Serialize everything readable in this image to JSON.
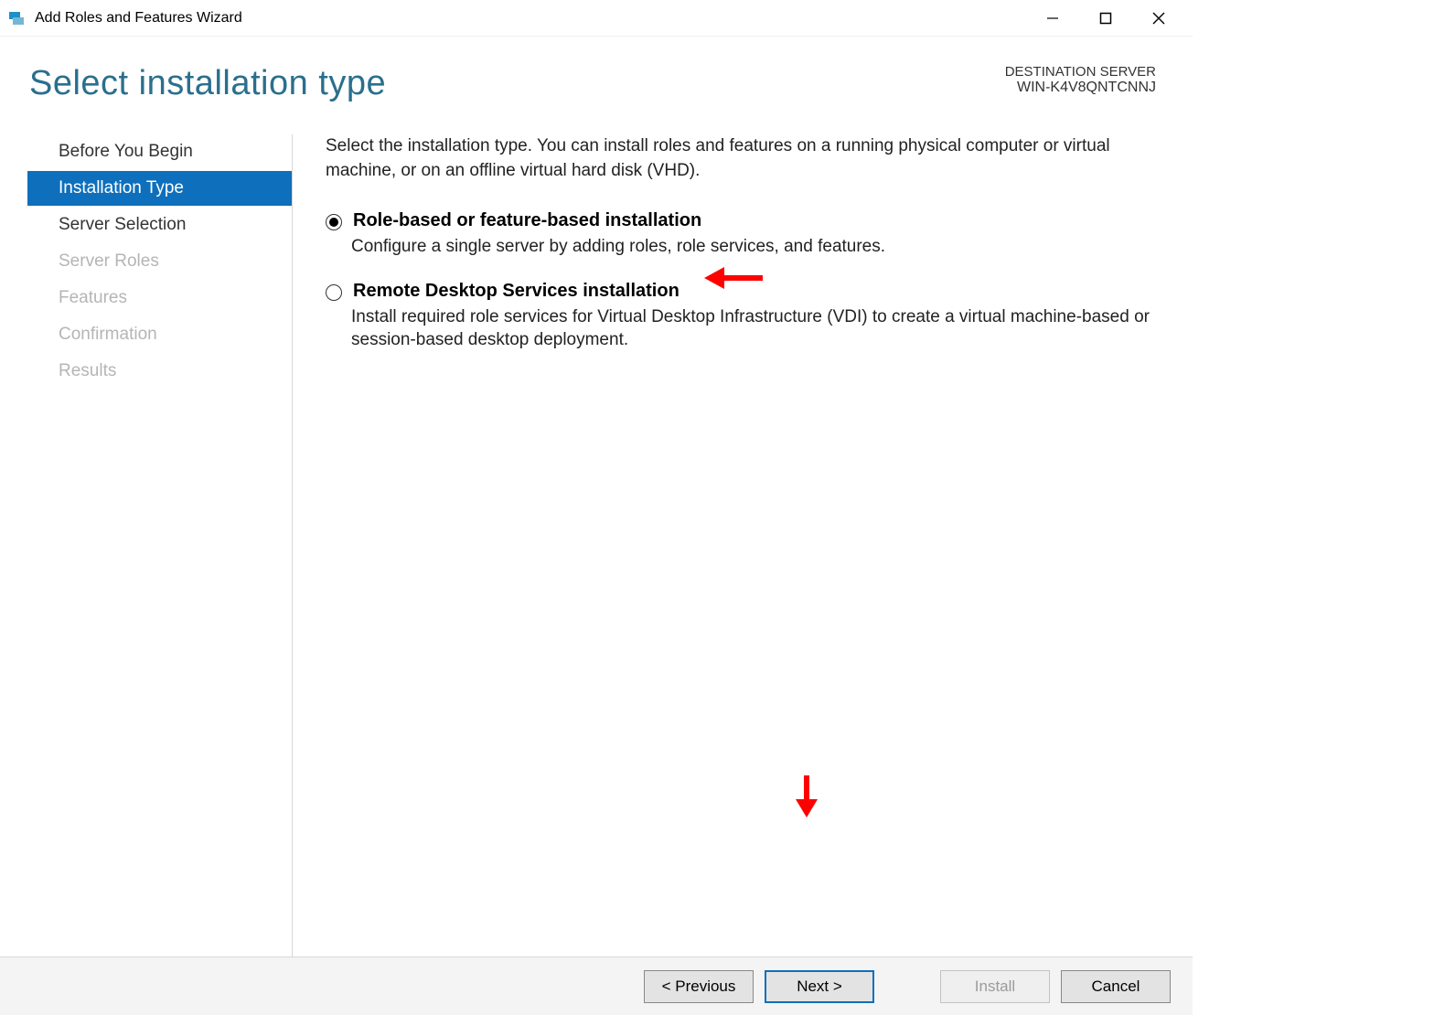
{
  "window": {
    "title": "Add Roles and Features Wizard"
  },
  "header": {
    "heading": "Select installation type",
    "dest_label": "DESTINATION SERVER",
    "dest_server": "WIN-K4V8QNTCNNJ"
  },
  "sidebar": {
    "items": [
      {
        "label": "Before You Begin",
        "state": "normal"
      },
      {
        "label": "Installation Type",
        "state": "active"
      },
      {
        "label": "Server Selection",
        "state": "normal"
      },
      {
        "label": "Server Roles",
        "state": "disabled"
      },
      {
        "label": "Features",
        "state": "disabled"
      },
      {
        "label": "Confirmation",
        "state": "disabled"
      },
      {
        "label": "Results",
        "state": "disabled"
      }
    ]
  },
  "main": {
    "intro": "Select the installation type. You can install roles and features on a running physical computer or virtual machine, or on an offline virtual hard disk (VHD).",
    "options": [
      {
        "title": "Role-based or feature-based installation",
        "desc": "Configure a single server by adding roles, role services, and features.",
        "selected": true
      },
      {
        "title": "Remote Desktop Services installation",
        "desc": "Install required role services for Virtual Desktop Infrastructure (VDI) to create a virtual machine-based or session-based desktop deployment.",
        "selected": false
      }
    ]
  },
  "footer": {
    "previous": "< Previous",
    "next": "Next >",
    "install": "Install",
    "cancel": "Cancel"
  }
}
